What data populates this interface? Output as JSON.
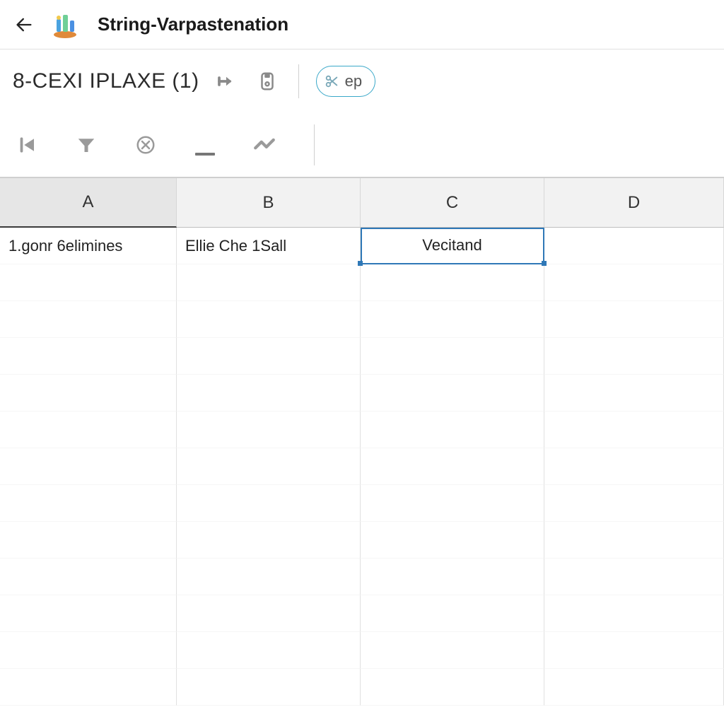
{
  "header": {
    "title": "String-Varpastenation"
  },
  "doc": {
    "name": "8-CEXI IPLAXE (1)"
  },
  "chip": {
    "label": "ep"
  },
  "columns": [
    "A",
    "B",
    "C",
    "D"
  ],
  "selected_column_index": 0,
  "selected_cell": {
    "row": 0,
    "col": 2
  },
  "rows": [
    {
      "A": "1.gonr 6elimines",
      "B": "Ellie Che 1Sall",
      "C": "Vecitand",
      "D": ""
    }
  ],
  "grid_total_rows": 13
}
